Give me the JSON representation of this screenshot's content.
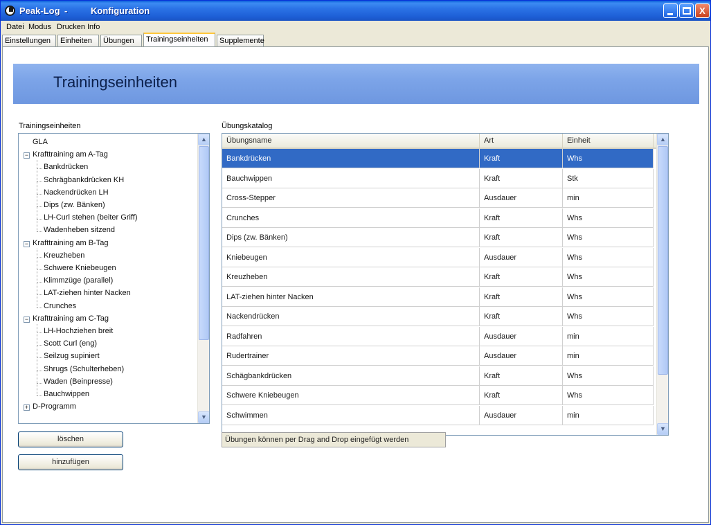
{
  "window": {
    "app_title": "Peak-Log",
    "separator": "-",
    "doc_title": "Konfiguration",
    "minimize_icon": "minimize-icon",
    "maximize_icon": "maximize-icon",
    "close_label": "X"
  },
  "menu": [
    "Datei",
    "Modus",
    "Drucken",
    "Info"
  ],
  "tabs": [
    {
      "label": "Einstellungen",
      "active": false
    },
    {
      "label": "Einheiten",
      "active": false
    },
    {
      "label": "Übungen",
      "active": false
    },
    {
      "label": "Trainingseinheiten",
      "active": true
    },
    {
      "label": "Supplemente",
      "active": false
    }
  ],
  "page_title": "Trainingseinheiten",
  "tree_panel": {
    "label": "Trainingseinheiten",
    "nodes": [
      {
        "text": "GLA",
        "level": 0,
        "expander": ""
      },
      {
        "text": "Krafttraining am A-Tag",
        "level": 0,
        "expander": "−"
      },
      {
        "text": "Bankdrücken",
        "level": 1
      },
      {
        "text": "Schrägbankdrücken KH",
        "level": 1
      },
      {
        "text": "Nackendrücken LH",
        "level": 1
      },
      {
        "text": "Dips (zw. Bänken)",
        "level": 1
      },
      {
        "text": "LH-Curl stehen (beiter Griff)",
        "level": 1
      },
      {
        "text": "Wadenheben sitzend",
        "level": 1
      },
      {
        "text": "Krafttraining am B-Tag",
        "level": 0,
        "expander": "−"
      },
      {
        "text": "Kreuzheben",
        "level": 1
      },
      {
        "text": "Schwere Kniebeugen",
        "level": 1
      },
      {
        "text": "Klimmzüge (parallel)",
        "level": 1
      },
      {
        "text": "LAT-ziehen hinter Nacken",
        "level": 1
      },
      {
        "text": "Crunches",
        "level": 1
      },
      {
        "text": "Krafttraining am C-Tag",
        "level": 0,
        "expander": "−"
      },
      {
        "text": "LH-Hochziehen breit",
        "level": 1
      },
      {
        "text": "Scott Curl (eng)",
        "level": 1
      },
      {
        "text": "Seilzug supiniert",
        "level": 1
      },
      {
        "text": "Shrugs (Schulterheben)",
        "level": 1
      },
      {
        "text": "Waden (Beinpresse)",
        "level": 1
      },
      {
        "text": "Bauchwippen",
        "level": 1
      },
      {
        "text": "D-Programm",
        "level": 0,
        "expander": "+"
      }
    ]
  },
  "buttons": {
    "delete": "löschen",
    "add": "hinzufügen"
  },
  "catalog": {
    "label": "Übungskatalog",
    "columns": [
      "Übungsname",
      "Art",
      "Einheit"
    ],
    "rows": [
      [
        "Bankdrücken",
        "Kraft",
        "Whs"
      ],
      [
        "Bauchwippen",
        "Kraft",
        "Stk"
      ],
      [
        "Cross-Stepper",
        "Ausdauer",
        "min"
      ],
      [
        "Crunches",
        "Kraft",
        "Whs"
      ],
      [
        "Dips (zw. Bänken)",
        "Kraft",
        "Whs"
      ],
      [
        "Kniebeugen",
        "Ausdauer",
        "Whs"
      ],
      [
        "Kreuzheben",
        "Kraft",
        "Whs"
      ],
      [
        "LAT-ziehen hinter Nacken",
        "Kraft",
        "Whs"
      ],
      [
        "Nackendrücken",
        "Kraft",
        "Whs"
      ],
      [
        "Radfahren",
        "Ausdauer",
        "min"
      ],
      [
        "Rudertrainer",
        "Ausdauer",
        "min"
      ],
      [
        "Schägbankdrücken",
        "Kraft",
        "Whs"
      ],
      [
        "Schwere Kniebeugen",
        "Kraft",
        "Whs"
      ],
      [
        "Schwimmen",
        "Ausdauer",
        "min"
      ]
    ],
    "selected_row": 0
  },
  "hint": "Übungen können per Drag and Drop eingefügt werden",
  "colors": {
    "selection": "#316ac5",
    "banner": "#7ca4e8",
    "titlebar": "#1d5fd6"
  }
}
